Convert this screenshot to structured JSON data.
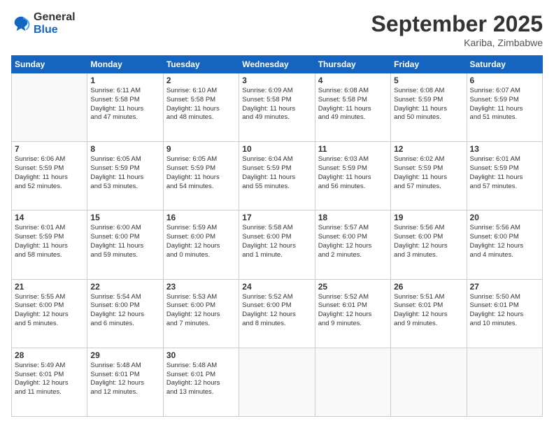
{
  "logo": {
    "line1": "General",
    "line2": "Blue"
  },
  "title": "September 2025",
  "location": "Kariba, Zimbabwe",
  "days_header": [
    "Sunday",
    "Monday",
    "Tuesday",
    "Wednesday",
    "Thursday",
    "Friday",
    "Saturday"
  ],
  "weeks": [
    [
      {
        "day": "",
        "info": ""
      },
      {
        "day": "1",
        "info": "Sunrise: 6:11 AM\nSunset: 5:58 PM\nDaylight: 11 hours\nand 47 minutes."
      },
      {
        "day": "2",
        "info": "Sunrise: 6:10 AM\nSunset: 5:58 PM\nDaylight: 11 hours\nand 48 minutes."
      },
      {
        "day": "3",
        "info": "Sunrise: 6:09 AM\nSunset: 5:58 PM\nDaylight: 11 hours\nand 49 minutes."
      },
      {
        "day": "4",
        "info": "Sunrise: 6:08 AM\nSunset: 5:58 PM\nDaylight: 11 hours\nand 49 minutes."
      },
      {
        "day": "5",
        "info": "Sunrise: 6:08 AM\nSunset: 5:59 PM\nDaylight: 11 hours\nand 50 minutes."
      },
      {
        "day": "6",
        "info": "Sunrise: 6:07 AM\nSunset: 5:59 PM\nDaylight: 11 hours\nand 51 minutes."
      }
    ],
    [
      {
        "day": "7",
        "info": "Sunrise: 6:06 AM\nSunset: 5:59 PM\nDaylight: 11 hours\nand 52 minutes."
      },
      {
        "day": "8",
        "info": "Sunrise: 6:05 AM\nSunset: 5:59 PM\nDaylight: 11 hours\nand 53 minutes."
      },
      {
        "day": "9",
        "info": "Sunrise: 6:05 AM\nSunset: 5:59 PM\nDaylight: 11 hours\nand 54 minutes."
      },
      {
        "day": "10",
        "info": "Sunrise: 6:04 AM\nSunset: 5:59 PM\nDaylight: 11 hours\nand 55 minutes."
      },
      {
        "day": "11",
        "info": "Sunrise: 6:03 AM\nSunset: 5:59 PM\nDaylight: 11 hours\nand 56 minutes."
      },
      {
        "day": "12",
        "info": "Sunrise: 6:02 AM\nSunset: 5:59 PM\nDaylight: 11 hours\nand 57 minutes."
      },
      {
        "day": "13",
        "info": "Sunrise: 6:01 AM\nSunset: 5:59 PM\nDaylight: 11 hours\nand 57 minutes."
      }
    ],
    [
      {
        "day": "14",
        "info": "Sunrise: 6:01 AM\nSunset: 5:59 PM\nDaylight: 11 hours\nand 58 minutes."
      },
      {
        "day": "15",
        "info": "Sunrise: 6:00 AM\nSunset: 6:00 PM\nDaylight: 11 hours\nand 59 minutes."
      },
      {
        "day": "16",
        "info": "Sunrise: 5:59 AM\nSunset: 6:00 PM\nDaylight: 12 hours\nand 0 minutes."
      },
      {
        "day": "17",
        "info": "Sunrise: 5:58 AM\nSunset: 6:00 PM\nDaylight: 12 hours\nand 1 minute."
      },
      {
        "day": "18",
        "info": "Sunrise: 5:57 AM\nSunset: 6:00 PM\nDaylight: 12 hours\nand 2 minutes."
      },
      {
        "day": "19",
        "info": "Sunrise: 5:56 AM\nSunset: 6:00 PM\nDaylight: 12 hours\nand 3 minutes."
      },
      {
        "day": "20",
        "info": "Sunrise: 5:56 AM\nSunset: 6:00 PM\nDaylight: 12 hours\nand 4 minutes."
      }
    ],
    [
      {
        "day": "21",
        "info": "Sunrise: 5:55 AM\nSunset: 6:00 PM\nDaylight: 12 hours\nand 5 minutes."
      },
      {
        "day": "22",
        "info": "Sunrise: 5:54 AM\nSunset: 6:00 PM\nDaylight: 12 hours\nand 6 minutes."
      },
      {
        "day": "23",
        "info": "Sunrise: 5:53 AM\nSunset: 6:00 PM\nDaylight: 12 hours\nand 7 minutes."
      },
      {
        "day": "24",
        "info": "Sunrise: 5:52 AM\nSunset: 6:00 PM\nDaylight: 12 hours\nand 8 minutes."
      },
      {
        "day": "25",
        "info": "Sunrise: 5:52 AM\nSunset: 6:01 PM\nDaylight: 12 hours\nand 9 minutes."
      },
      {
        "day": "26",
        "info": "Sunrise: 5:51 AM\nSunset: 6:01 PM\nDaylight: 12 hours\nand 9 minutes."
      },
      {
        "day": "27",
        "info": "Sunrise: 5:50 AM\nSunset: 6:01 PM\nDaylight: 12 hours\nand 10 minutes."
      }
    ],
    [
      {
        "day": "28",
        "info": "Sunrise: 5:49 AM\nSunset: 6:01 PM\nDaylight: 12 hours\nand 11 minutes."
      },
      {
        "day": "29",
        "info": "Sunrise: 5:48 AM\nSunset: 6:01 PM\nDaylight: 12 hours\nand 12 minutes."
      },
      {
        "day": "30",
        "info": "Sunrise: 5:48 AM\nSunset: 6:01 PM\nDaylight: 12 hours\nand 13 minutes."
      },
      {
        "day": "",
        "info": ""
      },
      {
        "day": "",
        "info": ""
      },
      {
        "day": "",
        "info": ""
      },
      {
        "day": "",
        "info": ""
      }
    ]
  ]
}
